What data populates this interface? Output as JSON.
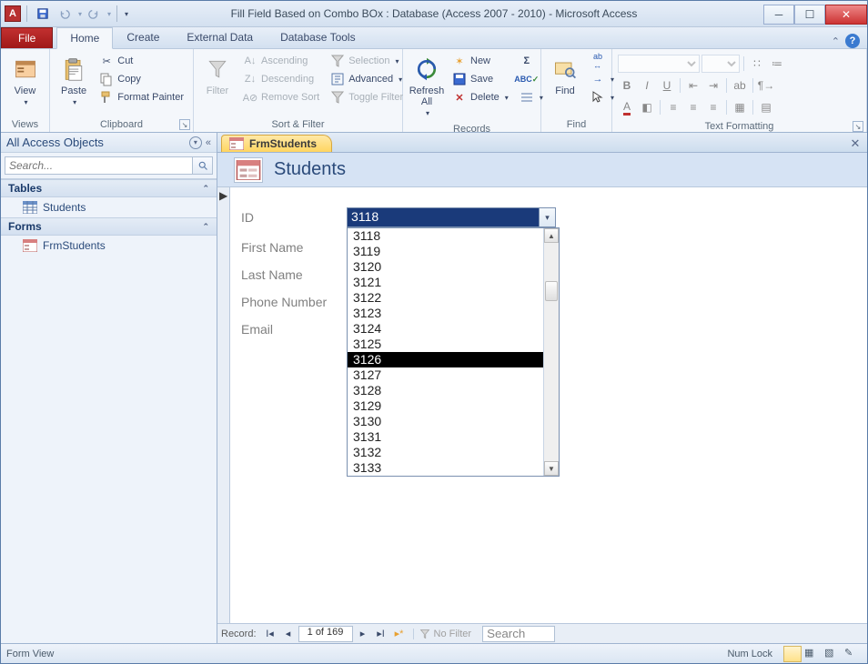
{
  "window": {
    "title": "Fill Field Based on Combo BOx : Database (Access 2007 - 2010)  -  Microsoft Access",
    "app_icon": "A"
  },
  "tabs": {
    "file": "File",
    "home": "Home",
    "create": "Create",
    "external": "External Data",
    "dbtools": "Database Tools"
  },
  "ribbon": {
    "views": {
      "view": "View",
      "group": "Views"
    },
    "clipboard": {
      "paste": "Paste",
      "cut": "Cut",
      "copy": "Copy",
      "fp": "Format Painter",
      "group": "Clipboard"
    },
    "sortfilter": {
      "filter": "Filter",
      "asc": "Ascending",
      "desc": "Descending",
      "remove": "Remove Sort",
      "selection": "Selection",
      "advanced": "Advanced",
      "toggle": "Toggle Filter",
      "group": "Sort & Filter"
    },
    "records": {
      "refresh": "Refresh All",
      "new": "New",
      "save": "Save",
      "delete": "Delete",
      "group": "Records"
    },
    "find": {
      "find": "Find",
      "group": "Find"
    },
    "textfmt": {
      "group": "Text Formatting"
    }
  },
  "nav": {
    "header": "All Access Objects",
    "search_ph": "Search...",
    "cat_tables": "Tables",
    "item_students": "Students",
    "cat_forms": "Forms",
    "item_frm": "FrmStudents"
  },
  "doc": {
    "tab": "FrmStudents",
    "form_title": "Students"
  },
  "form": {
    "labels": {
      "id": "ID",
      "first": "First Name",
      "last": "Last Name",
      "phone": "Phone Number",
      "email": "Email"
    },
    "combo_value": "3118",
    "dropdown_items": [
      "3118",
      "3119",
      "3120",
      "3121",
      "3122",
      "3123",
      "3124",
      "3125",
      "3126",
      "3127",
      "3128",
      "3129",
      "3130",
      "3131",
      "3132",
      "3133"
    ],
    "highlight_index": 8
  },
  "recnav": {
    "label": "Record:",
    "pos": "1 of 169",
    "nofilter": "No Filter",
    "search": "Search"
  },
  "status": {
    "left": "Form View",
    "numlock": "Num Lock"
  }
}
